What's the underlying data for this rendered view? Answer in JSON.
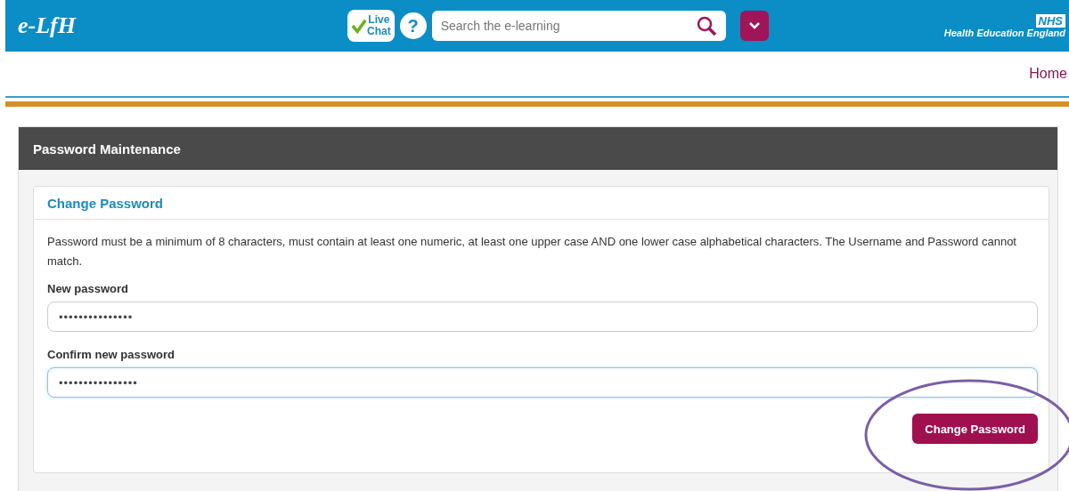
{
  "header": {
    "logo": "e-LfH",
    "live_chat": [
      "Live",
      "Chat"
    ],
    "help": "?",
    "search": {
      "placeholder": "Search the e-learning"
    },
    "nhs_badge": "NHS",
    "organisation": "Health Education England"
  },
  "nav": {
    "links": [
      "Home"
    ]
  },
  "panel": {
    "title": "Password Maintenance",
    "card": {
      "title": "Change Password",
      "instructions": "Password must be a minimum of 8 characters, must contain at least one numeric, at least one upper case AND one lower case alphabetical characters. The Username and Password cannot match.",
      "fields": [
        {
          "label": "New password",
          "value": "•••••••••••••••",
          "focused": false
        },
        {
          "label": "Confirm new password",
          "value": "••••••••••••••••",
          "focused": true
        }
      ],
      "button": "Change Password"
    }
  },
  "annotation": {
    "kind": "ellipse",
    "color": "#7b5ea7"
  }
}
